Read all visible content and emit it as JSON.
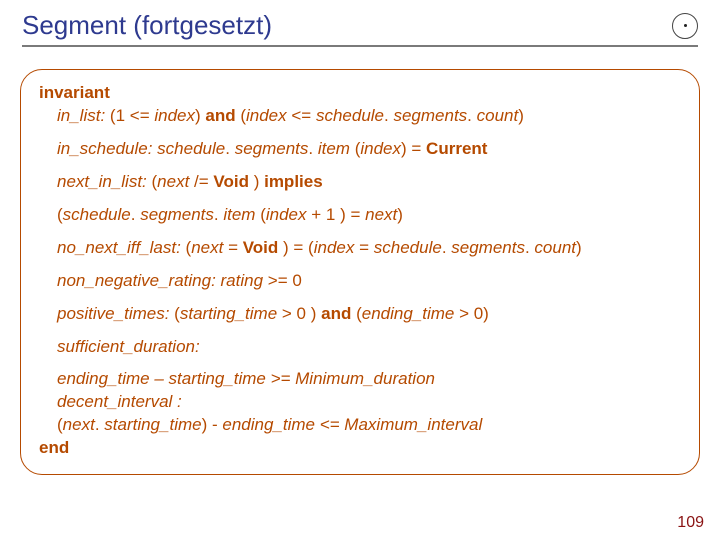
{
  "title": "Segment (fortgesetzt)",
  "logo_name": "ring-logo",
  "page_number": "109",
  "invariant": {
    "header": "invariant",
    "footer": "end",
    "clauses": [
      {
        "parts": [
          {
            "t": "in_list: ",
            "i": true
          },
          {
            "t": "(1 <= "
          },
          {
            "t": "index",
            "i": true
          },
          {
            "t": ") "
          },
          {
            "t": "and",
            "b": true
          },
          {
            "t": " ("
          },
          {
            "t": "index",
            "i": true
          },
          {
            "t": " <= "
          },
          {
            "t": "schedule",
            "i": true
          },
          {
            "t": ". "
          },
          {
            "t": "segments",
            "i": true
          },
          {
            "t": ". "
          },
          {
            "t": "count",
            "i": true
          },
          {
            "t": ")"
          }
        ]
      },
      {
        "parts": [
          {
            "t": "in_schedule: schedule",
            "i": true
          },
          {
            "t": ". "
          },
          {
            "t": "segments",
            "i": true
          },
          {
            "t": ". "
          },
          {
            "t": "item ",
            "i": true
          },
          {
            "t": "("
          },
          {
            "t": "index",
            "i": true
          },
          {
            "t": ")"
          },
          {
            "t": " = "
          },
          {
            "t": "Current",
            "b": true
          }
        ]
      },
      {
        "parts": [
          {
            "t": "next_in_list: ",
            "i": true
          },
          {
            "t": "("
          },
          {
            "t": "next ",
            "i": true
          },
          {
            "t": "/= "
          },
          {
            "t": "Void ",
            "b": true
          },
          {
            "t": ") "
          },
          {
            "t": "implies",
            "b": true
          }
        ]
      },
      {
        "parts": [
          {
            "t": "("
          },
          {
            "t": "schedule",
            "i": true
          },
          {
            "t": ". "
          },
          {
            "t": "segments",
            "i": true
          },
          {
            "t": ". "
          },
          {
            "t": "item ",
            "i": true
          },
          {
            "t": "("
          },
          {
            "t": "index ",
            "i": true
          },
          {
            "t": "+ 1 ) = "
          },
          {
            "t": "next",
            "i": true
          },
          {
            "t": ")"
          }
        ]
      },
      {
        "parts": [
          {
            "t": "no_next_iff_last: ",
            "i": true
          },
          {
            "t": "("
          },
          {
            "t": "next ",
            "i": true
          },
          {
            "t": "= "
          },
          {
            "t": "Void ",
            "b": true
          },
          {
            "t": ") = ("
          },
          {
            "t": "index ",
            "i": true
          },
          {
            "t": "= "
          },
          {
            "t": "schedule",
            "i": true
          },
          {
            "t": ". "
          },
          {
            "t": "segments",
            "i": true
          },
          {
            "t": ". "
          },
          {
            "t": "count",
            "i": true
          },
          {
            "t": ")"
          }
        ]
      },
      {
        "parts": [
          {
            "t": "non_negative_rating: rating ",
            "i": true
          },
          {
            "t": ">= 0"
          }
        ]
      },
      {
        "parts": [
          {
            "t": "positive_times: ",
            "i": true
          },
          {
            "t": "("
          },
          {
            "t": "starting_time ",
            "i": true
          },
          {
            "t": "> 0 ) "
          },
          {
            "t": "and",
            "b": true
          },
          {
            "t": "  ("
          },
          {
            "t": "ending_time ",
            "i": true
          },
          {
            "t": "> 0)"
          }
        ]
      },
      {
        "parts": [
          {
            "t": "sufficient_duration:",
            "i": true
          }
        ]
      },
      {
        "nomargin": true,
        "parts": [
          {
            "t": "ending_time – starting_time >= Minimum_duration",
            "i": true
          }
        ]
      },
      {
        "nomargin": true,
        "parts": [
          {
            "t": "decent_interval :",
            "i": true
          }
        ]
      },
      {
        "nomargin": true,
        "parts": [
          {
            "t": "("
          },
          {
            "t": "next",
            "i": true
          },
          {
            "t": ". "
          },
          {
            "t": "starting_time",
            "i": true
          },
          {
            "t": ") - "
          },
          {
            "t": "ending_time <= Maximum_interval",
            "i": true
          }
        ]
      }
    ]
  }
}
